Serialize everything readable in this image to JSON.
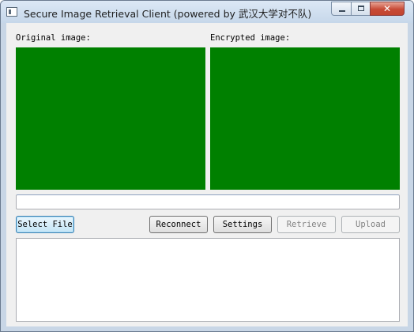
{
  "window": {
    "title": "Secure Image Retrieval Client (powered by 武汉大学对不队)",
    "icons": [
      "app-icon",
      "minimize-icon",
      "maximize-icon",
      "close-icon"
    ],
    "close_glyph": "✕"
  },
  "panels": {
    "original_label": "Original image:",
    "encrypted_label": "Encrypted image:",
    "pane_color": "#008000"
  },
  "file_path": {
    "value": "",
    "placeholder": ""
  },
  "buttons": {
    "select_file": "Select File",
    "reconnect": "Reconnect",
    "settings": "Settings",
    "retrieve": "Retrieve",
    "upload": "Upload"
  },
  "output": {
    "text": ""
  }
}
